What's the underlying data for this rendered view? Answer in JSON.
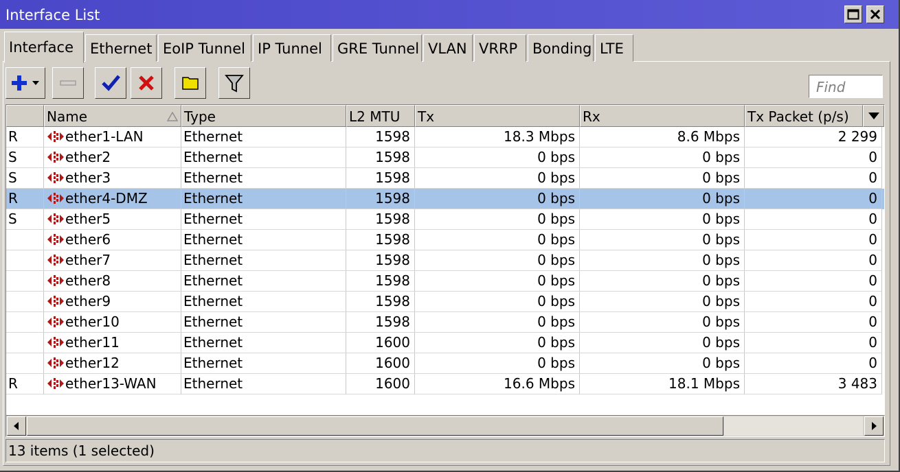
{
  "window": {
    "title": "Interface List"
  },
  "tabs": [
    "Interface",
    "Ethernet",
    "EoIP Tunnel",
    "IP Tunnel",
    "GRE Tunnel",
    "VLAN",
    "VRRP",
    "Bonding",
    "LTE"
  ],
  "toolbar": {
    "find_placeholder": "Find"
  },
  "table": {
    "columns": [
      "",
      "Name",
      "Type",
      "L2 MTU",
      "Tx",
      "Rx",
      "Tx Packet (p/s)"
    ],
    "rows": [
      {
        "flag": "R",
        "name": "ether1-LAN",
        "type": "Ethernet",
        "mtu": "1598",
        "tx": "18.3 Mbps",
        "rx": "8.6 Mbps",
        "txp": "2 299"
      },
      {
        "flag": "S",
        "name": "ether2",
        "type": "Ethernet",
        "mtu": "1598",
        "tx": "0 bps",
        "rx": "0 bps",
        "txp": "0"
      },
      {
        "flag": "S",
        "name": "ether3",
        "type": "Ethernet",
        "mtu": "1598",
        "tx": "0 bps",
        "rx": "0 bps",
        "txp": "0"
      },
      {
        "flag": "R",
        "name": "ether4-DMZ",
        "type": "Ethernet",
        "mtu": "1598",
        "tx": "0 bps",
        "rx": "0 bps",
        "txp": "0",
        "selected": true
      },
      {
        "flag": "S",
        "name": "ether5",
        "type": "Ethernet",
        "mtu": "1598",
        "tx": "0 bps",
        "rx": "0 bps",
        "txp": "0"
      },
      {
        "flag": "",
        "name": "ether6",
        "type": "Ethernet",
        "mtu": "1598",
        "tx": "0 bps",
        "rx": "0 bps",
        "txp": "0"
      },
      {
        "flag": "",
        "name": "ether7",
        "type": "Ethernet",
        "mtu": "1598",
        "tx": "0 bps",
        "rx": "0 bps",
        "txp": "0"
      },
      {
        "flag": "",
        "name": "ether8",
        "type": "Ethernet",
        "mtu": "1598",
        "tx": "0 bps",
        "rx": "0 bps",
        "txp": "0"
      },
      {
        "flag": "",
        "name": "ether9",
        "type": "Ethernet",
        "mtu": "1598",
        "tx": "0 bps",
        "rx": "0 bps",
        "txp": "0"
      },
      {
        "flag": "",
        "name": "ether10",
        "type": "Ethernet",
        "mtu": "1598",
        "tx": "0 bps",
        "rx": "0 bps",
        "txp": "0"
      },
      {
        "flag": "",
        "name": "ether11",
        "type": "Ethernet",
        "mtu": "1600",
        "tx": "0 bps",
        "rx": "0 bps",
        "txp": "0"
      },
      {
        "flag": "",
        "name": "ether12",
        "type": "Ethernet",
        "mtu": "1600",
        "tx": "0 bps",
        "rx": "0 bps",
        "txp": "0"
      },
      {
        "flag": "R",
        "name": "ether13-WAN",
        "type": "Ethernet",
        "mtu": "1600",
        "tx": "16.6 Mbps",
        "rx": "18.1 Mbps",
        "txp": "3 483"
      }
    ]
  },
  "status": {
    "text": "13 items (1 selected)"
  },
  "colors": {
    "titlebar": "#4a47c8",
    "selection": "#a6c4e8",
    "interface_icon": "#b01818"
  }
}
